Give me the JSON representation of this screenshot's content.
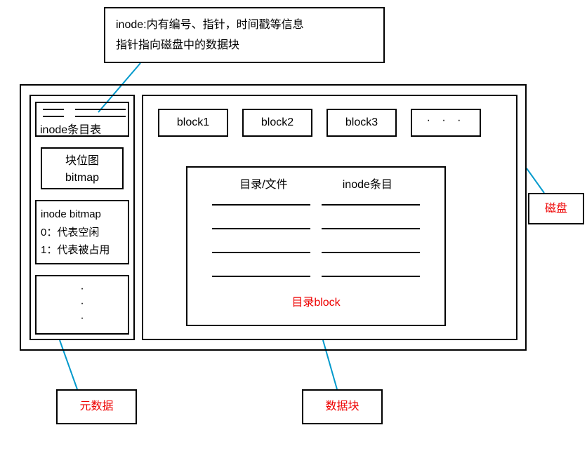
{
  "callout": {
    "line1": "inode:内有编号、指针，时间戳等信息",
    "line2": "指针指向磁盘中的数据块"
  },
  "metadata": {
    "inode_table_label": "inode条目表",
    "block_bitmap": {
      "line1": "块位图",
      "line2": "bitmap"
    },
    "inode_bitmap": {
      "title": "inode bitmap",
      "line0": "0：代表空闲",
      "line1": "1：代表被占用"
    },
    "dots": "·\n·\n·"
  },
  "blocks": {
    "b1": "block1",
    "b2": "block2",
    "b3": "block3",
    "dots": "· · ·"
  },
  "dir_block": {
    "header_left": "目录/文件",
    "header_right": "inode条目",
    "caption": "目录block"
  },
  "labels": {
    "disk": "磁盘",
    "metadata": "元数据",
    "datablock": "数据块"
  }
}
